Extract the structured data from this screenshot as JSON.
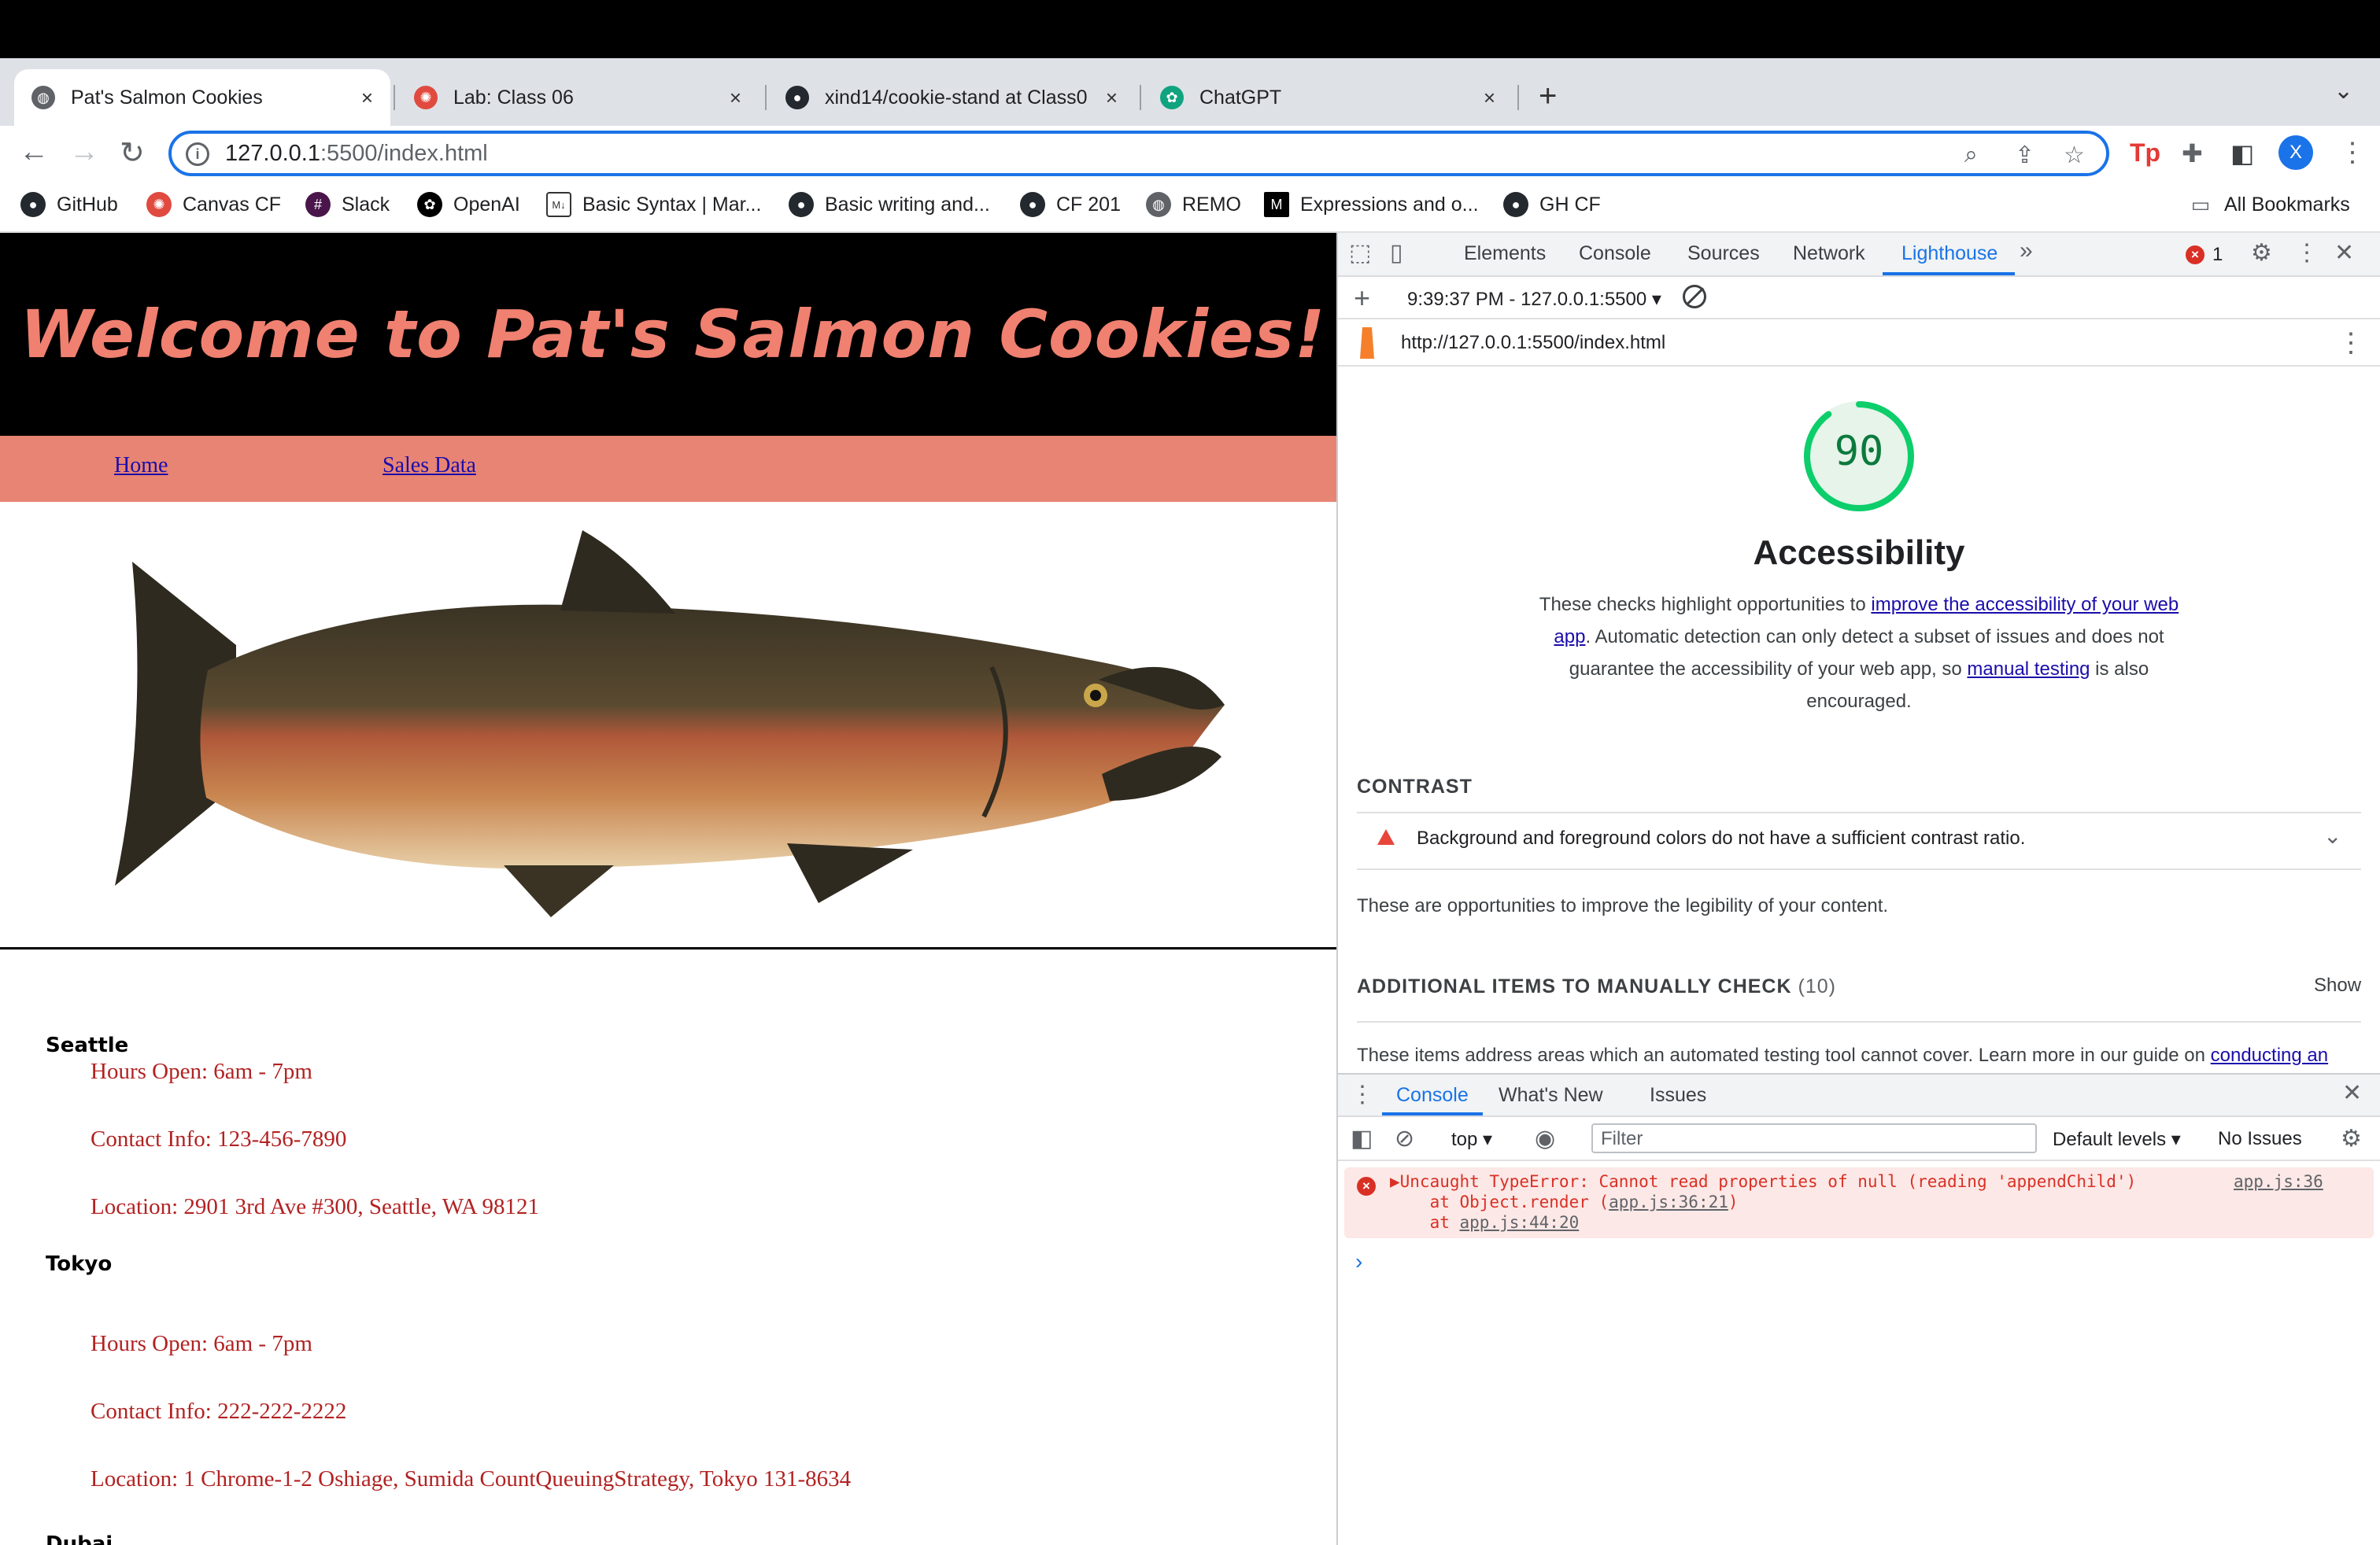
{
  "browser": {
    "tabs": [
      {
        "title": "Pat's Salmon Cookies",
        "active": true
      },
      {
        "title": "Lab: Class 06",
        "active": false
      },
      {
        "title": "xind14/cookie-stand at Class0",
        "active": false
      },
      {
        "title": "ChatGPT",
        "active": false
      }
    ],
    "tab_close": "×",
    "new_tab": "+",
    "url_host": "127.0.0.1",
    "url_rest": ":5500/index.html",
    "avatar_letter": "X",
    "bookmarks": [
      {
        "label": "GitHub"
      },
      {
        "label": "Canvas CF"
      },
      {
        "label": "Slack"
      },
      {
        "label": "OpenAI"
      },
      {
        "label": "Basic Syntax | Mar..."
      },
      {
        "label": "Basic writing and..."
      },
      {
        "label": "CF 201"
      },
      {
        "label": "REMO"
      },
      {
        "label": "Expressions and o..."
      },
      {
        "label": "GH CF"
      }
    ],
    "all_bookmarks": "All Bookmarks"
  },
  "site": {
    "title": "Welcome to Pat's Salmon Cookies!",
    "nav": [
      "Home",
      "Sales Data"
    ],
    "locations": [
      {
        "city": "Seattle",
        "hours": "Hours Open: 6am - 7pm",
        "contact": "Contact Info: 123-456-7890",
        "location": "Location: 2901 3rd Ave #300, Seattle, WA 98121"
      },
      {
        "city": "Tokyo",
        "hours": "Hours Open: 6am - 7pm",
        "contact": "Contact Info: 222-222-2222",
        "location": "Location: 1 Chrome-1-2 Oshiage, Sumida CountQueuingStrategy, Tokyo 131-8634"
      }
    ],
    "partial_city": "Dubai"
  },
  "devtools": {
    "tabs": [
      "Elements",
      "Console",
      "Sources",
      "Network",
      "Lighthouse"
    ],
    "selected_tab": "Lighthouse",
    "more": "»",
    "error_count": "1",
    "report_label": "9:39:37 PM - 127.0.0.1:5500 ▾",
    "report_url": "http://127.0.0.1:5500/index.html",
    "score": "90",
    "score_fraction": 0.9,
    "score_color": "#0cce6b",
    "category": "Accessibility",
    "desc": {
      "pre": "These checks highlight opportunities to ",
      "link1": "improve the accessibility of your web app",
      "mid": ". Automatic detection can only detect a subset of issues and does not guarantee the accessibility of your web app, so ",
      "link2": "manual testing",
      "post": " is also encouraged."
    },
    "contrast_heading": "CONTRAST",
    "contrast_audit": "Background and foreground colors do not have a sufficient contrast ratio.",
    "contrast_note": "These are opportunities to improve the legibility of your content.",
    "manual_heading": "ADDITIONAL ITEMS TO MANUALLY CHECK",
    "manual_count": "(10)",
    "show": "Show",
    "manual_note": "These items address areas which an automated testing tool cannot cover. Learn more in our guide on ",
    "manual_link": "conducting an",
    "drawer": {
      "tabs": [
        "Console",
        "What's New",
        "Issues"
      ],
      "context": "top",
      "filter_placeholder": "Filter",
      "levels": "Default levels ▾",
      "issues": "No Issues",
      "error_line1": "▶Uncaught TypeError: Cannot read properties of null (reading 'appendChild')",
      "error_at1_pre": "    at Object.render (",
      "error_at1_link": "app.js:36:21",
      "error_at1_post": ")",
      "error_at2_pre": "    at ",
      "error_at2_link": "app.js:44:20",
      "error_source": "app.js:36",
      "prompt": "›"
    }
  }
}
